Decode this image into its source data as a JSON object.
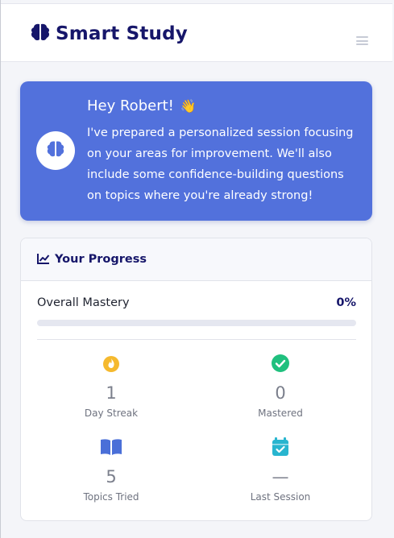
{
  "app": {
    "title": "Smart Study"
  },
  "greeting": {
    "title": "Hey Robert!",
    "emoji": "👋",
    "message": "I've prepared a personalized session focusing on your areas for improvement. We'll also include some confidence-building questions on topics where you're already strong!"
  },
  "progress": {
    "title": "Your Progress",
    "mastery_label": "Overall Mastery",
    "mastery_value": "0%",
    "mastery_fraction": 0,
    "stats": [
      {
        "icon": "flame-icon",
        "value": "1",
        "label": "Day Streak",
        "color": "#f5b92e"
      },
      {
        "icon": "check-circle-icon",
        "value": "0",
        "label": "Mastered",
        "color": "#20c07e"
      },
      {
        "icon": "book-icon",
        "value": "5",
        "label": "Topics Tried",
        "color": "#4a6fd8"
      },
      {
        "icon": "calendar-check-icon",
        "value": "—",
        "label": "Last Session",
        "color": "#28b5cf"
      }
    ]
  },
  "colors": {
    "brand": "#16166a",
    "accent": "#5271dc",
    "track": "#e5e7f0"
  }
}
